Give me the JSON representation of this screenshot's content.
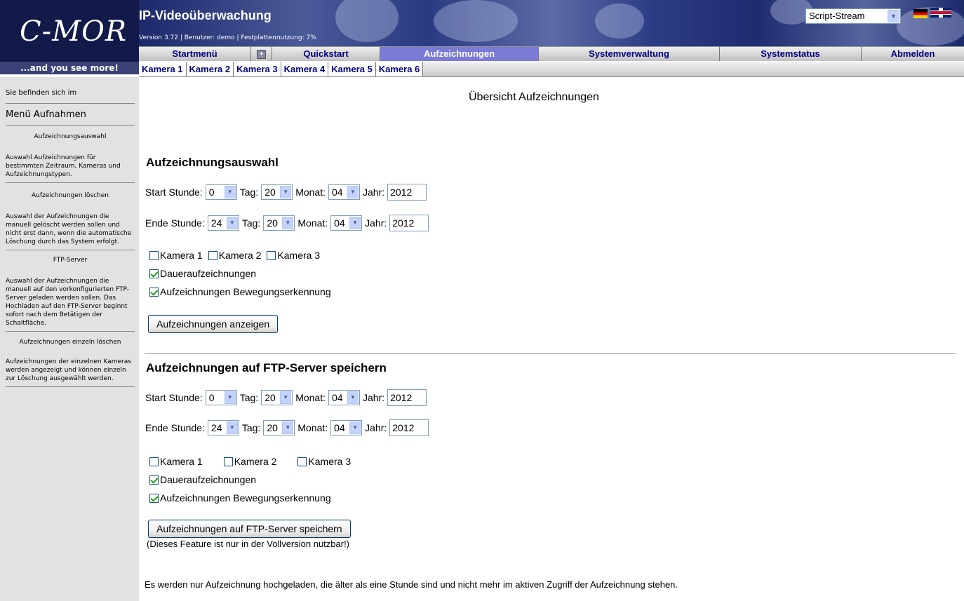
{
  "header": {
    "logo": "C-MOR",
    "slogan": "...and you see more!",
    "title": "IP-Videoüberwachung",
    "version_line": "Version 3.72 | Benutzer: demo | Festplattennutzung: 7%",
    "stream_select": "Script-Stream"
  },
  "nav": {
    "items": [
      "Startmenü",
      "Quickstart",
      "Aufzeichnungen",
      "Systemverwaltung",
      "Systemstatus",
      "Abmelden"
    ],
    "active": "Aufzeichnungen"
  },
  "cameras": [
    "Kamera 1",
    "Kamera 2",
    "Kamera 3",
    "Kamera 4",
    "Kamera 5",
    "Kamera 6"
  ],
  "sidebar": {
    "location": "Sie befinden sich im",
    "menu": "Menü Aufnahmen",
    "sections": [
      {
        "title": "Aufzeichnungsauswahl",
        "text": "Auswahl Aufzeichnungen für bestimmten Zeitraum, Kameras und Aufzeichnungstypen."
      },
      {
        "title": "Aufzeichnungen löschen",
        "text": "Auswahl der Aufzeichnungen die manuell gelöscht werden sollen und nicht erst dann, wenn die automatische Löschung durch das System erfolgt."
      },
      {
        "title": "FTP-Server",
        "text": "Auswahl der Aufzeichnungen die manuell auf den vorkonfigurierten FTP-Server geladen werden sollen. Das Hochladen auf den FTP-Server beginnt sofort nach dem Betätigen der Schaltfläche."
      },
      {
        "title": "Aufzeichnungen einzeln löschen",
        "text": "Aufzeichnungen der einzelnen Kameras werden angezeigt und können einzeln zur Löschung ausgewählt werden."
      }
    ]
  },
  "main": {
    "page_title": "Übersicht Aufzeichnungen",
    "labels": {
      "start_stunde": "Start Stunde:",
      "ende_stunde": "Ende Stunde:",
      "tag": "Tag:",
      "monat": "Monat:",
      "jahr": "Jahr:"
    },
    "selection": {
      "title": "Aufzeichnungsauswahl",
      "start": {
        "hour": "0",
        "day": "20",
        "month": "04",
        "year": "2012"
      },
      "end": {
        "hour": "24",
        "day": "20",
        "month": "04",
        "year": "2012"
      },
      "cameras": [
        {
          "label": "Kamera 1",
          "checked": false
        },
        {
          "label": "Kamera 2",
          "checked": false
        },
        {
          "label": "Kamera 3",
          "checked": false
        }
      ],
      "dauer": {
        "label": "Daueraufzeichnungen",
        "checked": true
      },
      "bewegung": {
        "label": "Aufzeichnungen Bewegungserkennung",
        "checked": true
      },
      "button": "Aufzeichnungen anzeigen"
    },
    "ftp": {
      "title": "Aufzeichnungen auf FTP-Server speichern",
      "start": {
        "hour": "0",
        "day": "20",
        "month": "04",
        "year": "2012"
      },
      "end": {
        "hour": "24",
        "day": "20",
        "month": "04",
        "year": "2012"
      },
      "cameras": [
        {
          "label": "Kamera 1",
          "checked": false
        },
        {
          "label": "Kamera 2",
          "checked": false
        },
        {
          "label": "Kamera 3",
          "checked": false
        }
      ],
      "dauer": {
        "label": "Daueraufzeichnungen",
        "checked": true
      },
      "bewegung": {
        "label": "Aufzeichnungen Bewegungserkennung",
        "checked": true
      },
      "button": "Aufzeichnungen auf FTP-Server speichern",
      "feature_note": "(Dieses Feature ist nur in der Vollversion nutzbar!)",
      "footer_note": "Es werden nur Aufzeichnung hochgeladen, die älter als eine Stunde sind und nicht mehr im aktiven Zugriff der Aufzeichnung stehen."
    }
  },
  "colors": {
    "logo_bg": "#121a4a",
    "nav_active": "#7b7bd6",
    "nav_text": "#000080",
    "sidebar_bg": "#e2e2e2"
  }
}
